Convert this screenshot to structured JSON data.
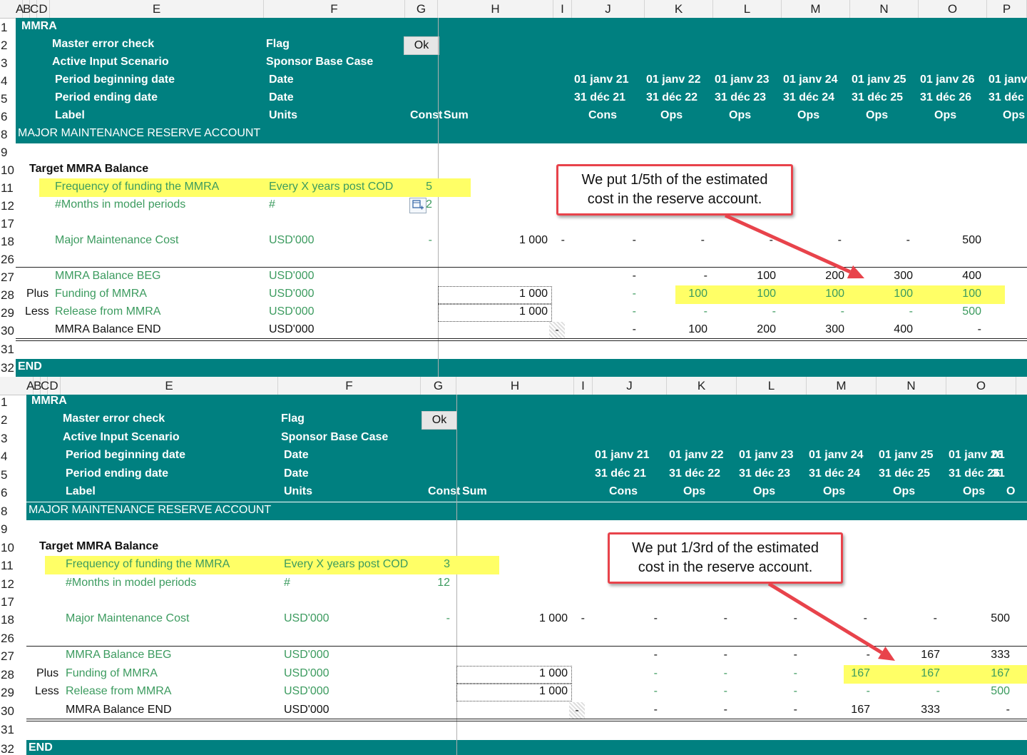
{
  "panel1": {
    "columns": [
      "A",
      "B",
      "C",
      "D",
      "E",
      "F",
      "G",
      "H",
      "I",
      "J",
      "K",
      "L",
      "M",
      "N",
      "O",
      "P"
    ],
    "row_numbers": [
      "1",
      "2",
      "3",
      "4",
      "5",
      "6",
      "8",
      "9",
      "10",
      "11",
      "12",
      "17",
      "18",
      "26",
      "27",
      "28",
      "29",
      "30",
      "31",
      "32"
    ],
    "title": "MMRA",
    "master_error_check": "Master error check",
    "flag": "Flag",
    "ok": "Ok",
    "active_input_scenario": "Active Input Scenario",
    "scenario_value": "Sponsor Base Case",
    "period_beginning": "Period beginning date",
    "period_ending": "Period ending date",
    "label": "Label",
    "date": "Date",
    "units": "Units",
    "const": "Const",
    "sum": "Sum",
    "begin_dates": [
      "01 janv 21",
      "01 janv 22",
      "01 janv 23",
      "01 janv 24",
      "01 janv 25",
      "01 janv 26",
      "01 janv"
    ],
    "end_dates": [
      "31 déc 21",
      "31 déc 22",
      "31 déc 23",
      "31 déc 24",
      "31 déc 25",
      "31 déc 26",
      "31 déc"
    ],
    "phases": [
      "Cons",
      "Ops",
      "Ops",
      "Ops",
      "Ops",
      "Ops",
      "Ops"
    ],
    "section": "MAJOR MAINTENANCE RESERVE ACCOUNT",
    "target_title": "Target MMRA Balance",
    "freq_label": "Frequency of funding the MMRA",
    "freq_unit": "Every X years post COD",
    "freq_value": "5",
    "months_label": "#Months in model periods",
    "months_unit": "#",
    "months_value": "2",
    "cost_label": "Major Maintenance Cost",
    "cost_unit": "USD'000",
    "cost_const": "-",
    "cost_sum": "1 000",
    "cost_values": [
      "-",
      "-",
      "-",
      "-",
      "-",
      "-",
      "500"
    ],
    "beg_label": "MMRA Balance BEG",
    "beg_unit": "USD'000",
    "beg_values": [
      "-",
      "-",
      "100",
      "200",
      "300",
      "400"
    ],
    "plus": "Plus",
    "fund_label": "Funding of MMRA",
    "fund_unit": "USD'000",
    "fund_sum": "1 000",
    "fund_values": [
      "-",
      "100",
      "100",
      "100",
      "100",
      "100"
    ],
    "less": "Less",
    "rel_label": "Release from MMRA",
    "rel_unit": "USD'000",
    "rel_sum": "1 000",
    "rel_values": [
      "-",
      "-",
      "-",
      "-",
      "-",
      "500"
    ],
    "end_label": "MMRA Balance END",
    "end_unit": "USD'000",
    "end_sum": "-",
    "end_values": [
      "-",
      "100",
      "200",
      "300",
      "400",
      "-"
    ],
    "end": "END",
    "callout_line1": "We put 1/5th of the estimated",
    "callout_line2": "cost in the reserve account."
  },
  "panel2": {
    "columns": [
      "A",
      "B",
      "C",
      "D",
      "E",
      "F",
      "G",
      "H",
      "I",
      "J",
      "K",
      "L",
      "M",
      "N",
      "O"
    ],
    "row_numbers": [
      "1",
      "2",
      "3",
      "4",
      "5",
      "6",
      "8",
      "9",
      "10",
      "11",
      "12",
      "17",
      "18",
      "26",
      "27",
      "28",
      "29",
      "30",
      "31",
      "32"
    ],
    "title": "MMRA",
    "master_error_check": "Master error check",
    "flag": "Flag",
    "ok": "Ok",
    "active_input_scenario": "Active Input Scenario",
    "scenario_value": "Sponsor Base Case",
    "period_beginning": "Period beginning date",
    "period_ending": "Period ending date",
    "label": "Label",
    "date": "Date",
    "units": "Units",
    "const": "Const",
    "sum": "Sum",
    "begin_dates": [
      "01 janv 21",
      "01 janv 22",
      "01 janv 23",
      "01 janv 24",
      "01 janv 25",
      "01 janv 26",
      "01"
    ],
    "end_dates": [
      "31 déc 21",
      "31 déc 22",
      "31 déc 23",
      "31 déc 24",
      "31 déc 25",
      "31 déc 26",
      "31"
    ],
    "phases": [
      "Cons",
      "Ops",
      "Ops",
      "Ops",
      "Ops",
      "Ops",
      "O"
    ],
    "section": "MAJOR MAINTENANCE RESERVE ACCOUNT",
    "target_title": "Target MMRA Balance",
    "freq_label": "Frequency of funding the MMRA",
    "freq_unit": "Every X years post COD",
    "freq_value": "3",
    "months_label": "#Months in model periods",
    "months_unit": "#",
    "months_value": "12",
    "cost_label": "Major Maintenance Cost",
    "cost_unit": "USD'000",
    "cost_const": "-",
    "cost_sum": "1 000",
    "cost_values": [
      "-",
      "-",
      "-",
      "-",
      "-",
      "-",
      "500"
    ],
    "beg_label": "MMRA Balance BEG",
    "beg_unit": "USD'000",
    "beg_values": [
      "-",
      "-",
      "-",
      "-",
      "167",
      "333"
    ],
    "plus": "Plus",
    "fund_label": "Funding of MMRA",
    "fund_unit": "USD'000",
    "fund_sum": "1 000",
    "fund_values": [
      "-",
      "-",
      "-",
      "167",
      "167",
      "167"
    ],
    "less": "Less",
    "rel_label": "Release from MMRA",
    "rel_unit": "USD'000",
    "rel_sum": "1 000",
    "rel_values": [
      "-",
      "-",
      "-",
      "-",
      "-",
      "500"
    ],
    "end_label": "MMRA Balance END",
    "end_unit": "USD'000",
    "end_sum": "-",
    "end_values": [
      "-",
      "-",
      "-",
      "167",
      "333",
      "-"
    ],
    "end": "END",
    "callout_line1": "We put 1/3rd of the estimated",
    "callout_line2": "cost in the reserve account."
  }
}
